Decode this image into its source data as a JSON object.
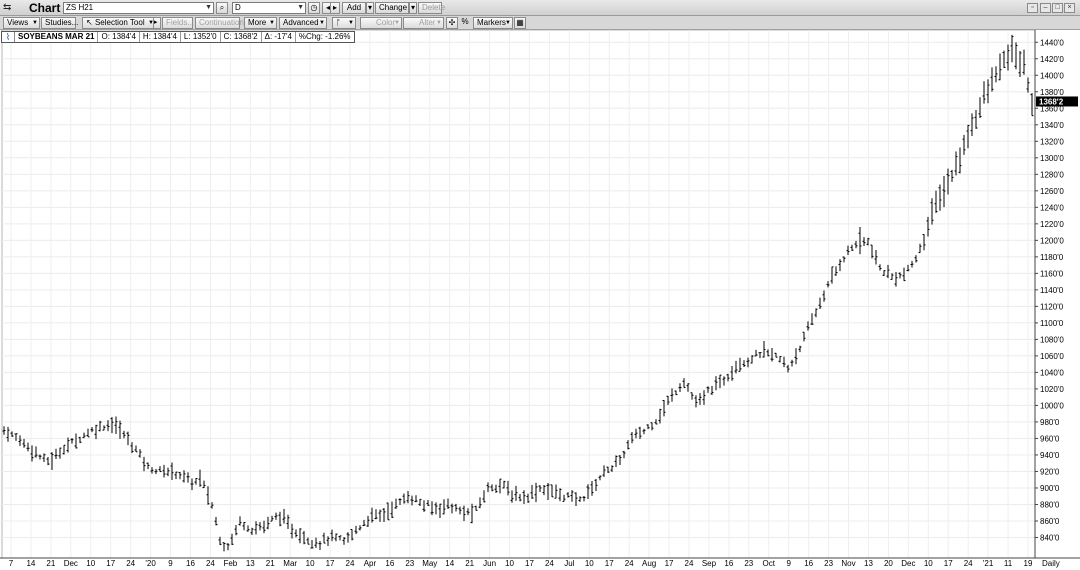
{
  "window": {
    "title": "Chart",
    "symbol_value": "ZS H21",
    "period_value": "D",
    "buttons": {
      "add": "Add",
      "change": "Change",
      "delete": "Delete"
    }
  },
  "toolbar": {
    "views": "Views",
    "studies": "Studies...",
    "selection_tool": "Selection Tool",
    "fields": "Fields...",
    "continuation": "Continuation",
    "more": "More",
    "advanced": "Advanced",
    "color": "Color",
    "alter": "Alter",
    "percent": "%",
    "markers": "Markers"
  },
  "legend": {
    "symbol": "SOYBEANS MAR 21",
    "open": "O: 1384'4",
    "high": "H: 1384'4",
    "low": "L: 1352'0",
    "close": "C: 1368'2",
    "change": "Δ: -17'4",
    "pct_change": "%Chg: -1.26%"
  },
  "last_price_label": "1368'2",
  "period_label": "Daily",
  "chart_data": {
    "type": "bar",
    "title": "SOYBEANS MAR 21",
    "ylim": [
      820,
      1450
    ],
    "yticks": [
      "840'0",
      "860'0",
      "880'0",
      "900'0",
      "920'0",
      "940'0",
      "960'0",
      "980'0",
      "1000'0",
      "1020'0",
      "1040'0",
      "1060'0",
      "1080'0",
      "1100'0",
      "1120'0",
      "1140'0",
      "1160'0",
      "1180'0",
      "1200'0",
      "1220'0",
      "1240'0",
      "1260'0",
      "1280'0",
      "1300'0",
      "1320'0",
      "1340'0",
      "1360'0",
      "1380'0",
      "1400'0",
      "1420'0",
      "1440'0"
    ],
    "xticks": [
      "7",
      "14",
      "21",
      "Dec",
      "10",
      "17",
      "24",
      "'20",
      "9",
      "16",
      "24",
      "Feb",
      "13",
      "21",
      "Mar",
      "10",
      "17",
      "24",
      "Apr",
      "16",
      "23",
      "May",
      "14",
      "21",
      "Jun",
      "10",
      "17",
      "24",
      "Jul",
      "10",
      "17",
      "24",
      "Aug",
      "17",
      "24",
      "Sep",
      "16",
      "23",
      "Oct",
      "9",
      "16",
      "23",
      "Nov",
      "13",
      "20",
      "Dec",
      "10",
      "17",
      "24",
      "'21",
      "11",
      "19"
    ],
    "keypoints": [
      [
        0,
        970
      ],
      [
        0.5,
        965
      ],
      [
        1.5,
        955
      ],
      [
        2.5,
        942
      ],
      [
        3.2,
        932
      ],
      [
        3.8,
        935
      ],
      [
        4.5,
        948
      ],
      [
        5.5,
        958
      ],
      [
        6.5,
        968
      ],
      [
        7.5,
        975
      ],
      [
        8.3,
        978
      ],
      [
        8.9,
        970
      ],
      [
        9.5,
        958
      ],
      [
        10.2,
        945
      ],
      [
        11,
        925
      ],
      [
        12,
        920
      ],
      [
        13,
        920
      ],
      [
        13.9,
        912
      ],
      [
        14.5,
        905
      ],
      [
        15,
        912
      ],
      [
        15.5,
        895
      ],
      [
        16,
        875
      ],
      [
        16.5,
        838
      ],
      [
        17,
        828
      ],
      [
        17.5,
        840
      ],
      [
        18,
        860
      ],
      [
        19,
        850
      ],
      [
        20,
        855
      ],
      [
        21,
        868
      ],
      [
        22,
        850
      ],
      [
        23,
        840
      ],
      [
        24,
        833
      ],
      [
        25,
        840
      ],
      [
        26,
        835
      ],
      [
        27,
        850
      ],
      [
        28,
        865
      ],
      [
        29,
        868
      ],
      [
        30,
        880
      ],
      [
        31,
        890
      ],
      [
        32,
        880
      ],
      [
        33,
        875
      ],
      [
        34,
        880
      ],
      [
        35,
        870
      ],
      [
        36,
        870
      ],
      [
        37,
        900
      ],
      [
        38,
        905
      ],
      [
        39,
        890
      ],
      [
        40,
        890
      ],
      [
        41,
        900
      ],
      [
        42,
        895
      ],
      [
        43,
        890
      ],
      [
        44,
        885
      ],
      [
        45,
        900
      ],
      [
        46,
        922
      ],
      [
        47,
        930
      ],
      [
        48,
        960
      ],
      [
        49,
        970
      ],
      [
        50,
        985
      ],
      [
        51,
        1010
      ],
      [
        52,
        1030
      ],
      [
        53,
        1000
      ],
      [
        54,
        1020
      ],
      [
        55,
        1030
      ],
      [
        56,
        1050
      ],
      [
        57,
        1055
      ],
      [
        58,
        1065
      ],
      [
        59,
        1060
      ],
      [
        60,
        1045
      ],
      [
        61,
        1075
      ],
      [
        62,
        1110
      ],
      [
        63,
        1145
      ],
      [
        64,
        1175
      ],
      [
        65,
        1195
      ],
      [
        66,
        1200
      ],
      [
        67,
        1165
      ],
      [
        68,
        1155
      ],
      [
        69,
        1160
      ],
      [
        70,
        1185
      ],
      [
        71,
        1235
      ],
      [
        72,
        1265
      ],
      [
        73,
        1295
      ],
      [
        74,
        1340
      ],
      [
        75,
        1375
      ],
      [
        76,
        1405
      ],
      [
        77,
        1430
      ],
      [
        78,
        1410
      ],
      [
        78.6,
        1368
      ]
    ]
  }
}
